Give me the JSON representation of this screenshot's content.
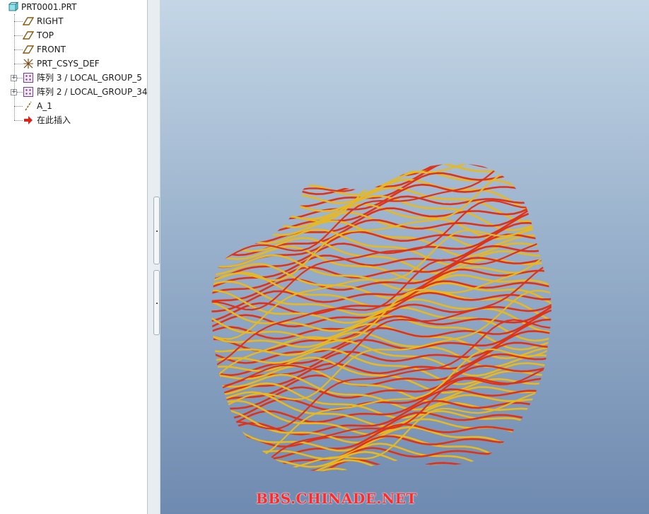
{
  "model_tree": {
    "root": {
      "label": "PRT0001.PRT",
      "icon": "part-icon"
    },
    "items": [
      {
        "label": "RIGHT",
        "icon": "datum-plane-icon",
        "expandable": false
      },
      {
        "label": "TOP",
        "icon": "datum-plane-icon",
        "expandable": false
      },
      {
        "label": "FRONT",
        "icon": "datum-plane-icon",
        "expandable": false
      },
      {
        "label": "PRT_CSYS_DEF",
        "icon": "coordinate-system-icon",
        "expandable": false
      },
      {
        "label": "阵列 3 / LOCAL_GROUP_5",
        "icon": "pattern-icon",
        "expandable": true
      },
      {
        "label": "阵列 2 / LOCAL_GROUP_34",
        "icon": "pattern-icon",
        "expandable": true
      },
      {
        "label": "A_1",
        "icon": "datum-axis-icon",
        "expandable": false
      },
      {
        "label": "在此插入",
        "icon": "insert-here-arrow-icon",
        "expandable": false
      }
    ]
  },
  "viewport": {
    "watermark": "BBS.CHINADE.NET",
    "colors": {
      "curve_red": "#e03218",
      "curve_yellow": "#e8b820",
      "bg_top": "#c4d6e6",
      "bg_bottom": "#6f8ab0",
      "watermark": "#ff2a2a"
    }
  }
}
